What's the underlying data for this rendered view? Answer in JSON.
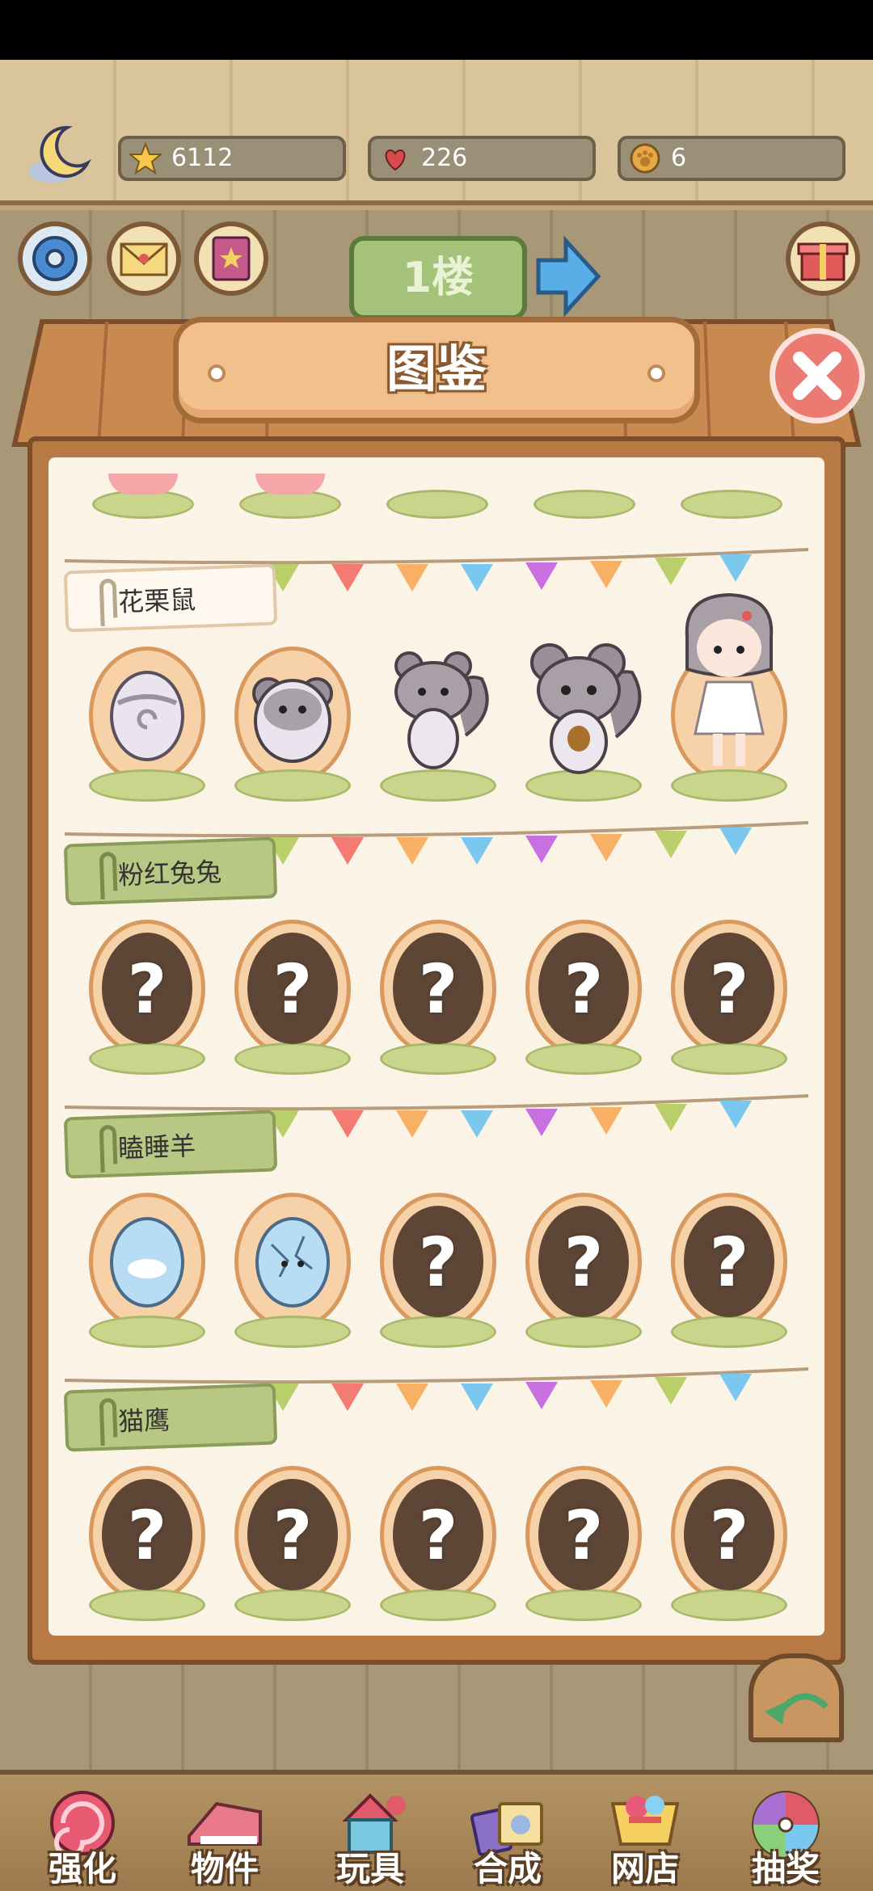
{
  "resources": {
    "stars": "6112",
    "hearts": "226",
    "coins": "6"
  },
  "header": {
    "floor_label": "1楼"
  },
  "panel": {
    "title": "图鉴"
  },
  "categories": [
    {
      "name": "花栗鼠",
      "unlocked": true,
      "slots": [
        "egg",
        "hatching",
        "chipmunk",
        "chipmunk-acorn",
        "chipmunk-girl"
      ]
    },
    {
      "name": "粉红兔兔",
      "unlocked": false,
      "slots": [
        "?",
        "?",
        "?",
        "?",
        "?"
      ]
    },
    {
      "name": "瞌睡羊",
      "unlocked": false,
      "slots": [
        "egg",
        "hatching",
        "?",
        "?",
        "?"
      ]
    },
    {
      "name": "猫鹰",
      "unlocked": false,
      "slots": [
        "?",
        "?",
        "?",
        "?",
        "?"
      ]
    }
  ],
  "bottom_nav": [
    {
      "label": "强化",
      "icon": "lollipop-icon"
    },
    {
      "label": "物件",
      "icon": "piano-icon"
    },
    {
      "label": "玩具",
      "icon": "toy-house-icon"
    },
    {
      "label": "合成",
      "icon": "cards-icon"
    },
    {
      "label": "网店",
      "icon": "shop-cart-icon"
    },
    {
      "label": "抽奖",
      "icon": "wheel-icon"
    }
  ],
  "colors": {
    "panel_bg": "#fbf4e6",
    "wood": "#b77a45",
    "close_red": "#ea7a72",
    "tag_green": "#b9c784"
  }
}
